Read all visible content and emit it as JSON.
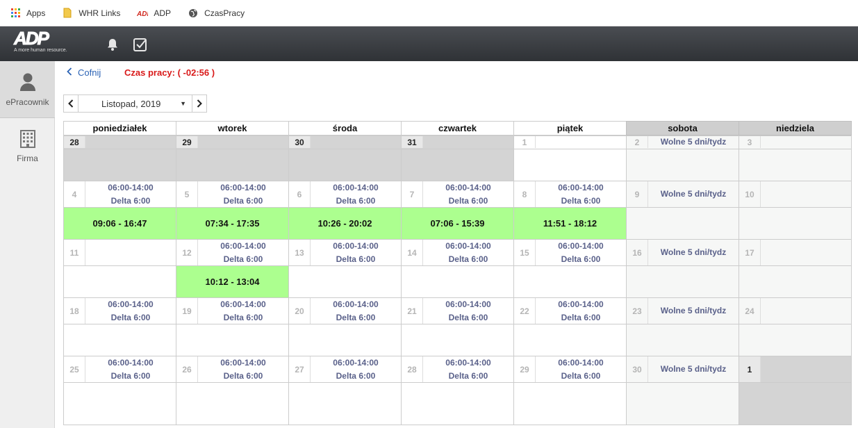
{
  "bookmarks": [
    {
      "label": "Apps",
      "icon": "apps-grid-icon"
    },
    {
      "label": "WHR Links",
      "icon": "folder-icon"
    },
    {
      "label": "ADP",
      "icon": "adp-icon"
    },
    {
      "label": "CzasPracy",
      "icon": "globe-icon"
    }
  ],
  "header": {
    "logo": "ADP",
    "tagline": "A more human resource.",
    "icons": [
      "bell-icon",
      "checkbox-icon"
    ]
  },
  "sidebar": [
    {
      "label": "ePracownik",
      "icon": "person-icon",
      "active": true
    },
    {
      "label": "Firma",
      "icon": "building-icon",
      "active": false
    }
  ],
  "main": {
    "back_label": "Cofnij",
    "work_time": "Czas pracy: ( -02:56 )",
    "month": "Listopad, 2019"
  },
  "colors": {
    "accent": "#2b63b5",
    "alert": "#d91a1a",
    "worked": "#acff8f",
    "weekend": "#cfcfcf",
    "schedule_text": "#5a618a"
  },
  "calendar": {
    "weekdays": [
      "poniedziałek",
      "wtorek",
      "środa",
      "czwartek",
      "piątek",
      "sobota",
      "niedziela"
    ],
    "weeks": [
      {
        "days": [
          {
            "num": "28",
            "line1": "",
            "line2": "",
            "outside": true
          },
          {
            "num": "29",
            "line1": "",
            "line2": "",
            "outside": true
          },
          {
            "num": "30",
            "line1": "",
            "line2": "",
            "outside": true
          },
          {
            "num": "31",
            "line1": "",
            "line2": "",
            "outside": true
          },
          {
            "num": "1",
            "line1": "",
            "line2": ""
          },
          {
            "num": "2",
            "line1": "Wolne 5 dni/tydz",
            "line2": ""
          },
          {
            "num": "3",
            "line1": "",
            "line2": ""
          }
        ],
        "worked": [
          "",
          "",
          "",
          "",
          "",
          "",
          ""
        ]
      },
      {
        "days": [
          {
            "num": "4",
            "line1": "06:00-14:00",
            "line2": "Delta 6:00"
          },
          {
            "num": "5",
            "line1": "06:00-14:00",
            "line2": "Delta 6:00"
          },
          {
            "num": "6",
            "line1": "06:00-14:00",
            "line2": "Delta 6:00"
          },
          {
            "num": "7",
            "line1": "06:00-14:00",
            "line2": "Delta 6:00"
          },
          {
            "num": "8",
            "line1": "06:00-14:00",
            "line2": "Delta 6:00"
          },
          {
            "num": "9",
            "line1": "Wolne 5 dni/tydz",
            "line2": ""
          },
          {
            "num": "10",
            "line1": "",
            "line2": ""
          }
        ],
        "worked": [
          "09:06 - 16:47",
          "07:34 - 17:35",
          "10:26 - 20:02",
          "07:06 - 15:39",
          "11:51 - 18:12",
          "",
          ""
        ]
      },
      {
        "days": [
          {
            "num": "11",
            "line1": "",
            "line2": ""
          },
          {
            "num": "12",
            "line1": "06:00-14:00",
            "line2": "Delta 6:00"
          },
          {
            "num": "13",
            "line1": "06:00-14:00",
            "line2": "Delta 6:00"
          },
          {
            "num": "14",
            "line1": "06:00-14:00",
            "line2": "Delta 6:00"
          },
          {
            "num": "15",
            "line1": "06:00-14:00",
            "line2": "Delta 6:00"
          },
          {
            "num": "16",
            "line1": "Wolne 5 dni/tydz",
            "line2": ""
          },
          {
            "num": "17",
            "line1": "",
            "line2": ""
          }
        ],
        "worked": [
          "",
          "10:12 - 13:04",
          "",
          "",
          "",
          "",
          ""
        ]
      },
      {
        "days": [
          {
            "num": "18",
            "line1": "06:00-14:00",
            "line2": "Delta 6:00"
          },
          {
            "num": "19",
            "line1": "06:00-14:00",
            "line2": "Delta 6:00"
          },
          {
            "num": "20",
            "line1": "06:00-14:00",
            "line2": "Delta 6:00"
          },
          {
            "num": "21",
            "line1": "06:00-14:00",
            "line2": "Delta 6:00"
          },
          {
            "num": "22",
            "line1": "06:00-14:00",
            "line2": "Delta 6:00"
          },
          {
            "num": "23",
            "line1": "Wolne 5 dni/tydz",
            "line2": ""
          },
          {
            "num": "24",
            "line1": "",
            "line2": ""
          }
        ],
        "worked": [
          "",
          "",
          "",
          "",
          "",
          "",
          ""
        ]
      },
      {
        "days": [
          {
            "num": "25",
            "line1": "06:00-14:00",
            "line2": "Delta 6:00"
          },
          {
            "num": "26",
            "line1": "06:00-14:00",
            "line2": "Delta 6:00"
          },
          {
            "num": "27",
            "line1": "06:00-14:00",
            "line2": "Delta 6:00"
          },
          {
            "num": "28",
            "line1": "06:00-14:00",
            "line2": "Delta 6:00"
          },
          {
            "num": "29",
            "line1": "06:00-14:00",
            "line2": "Delta 6:00"
          },
          {
            "num": "30",
            "line1": "Wolne 5 dni/tydz",
            "line2": ""
          },
          {
            "num": "1",
            "line1": "",
            "line2": "",
            "outside": true
          }
        ],
        "worked": [
          "",
          "",
          "",
          "",
          "",
          "",
          ""
        ]
      }
    ]
  }
}
